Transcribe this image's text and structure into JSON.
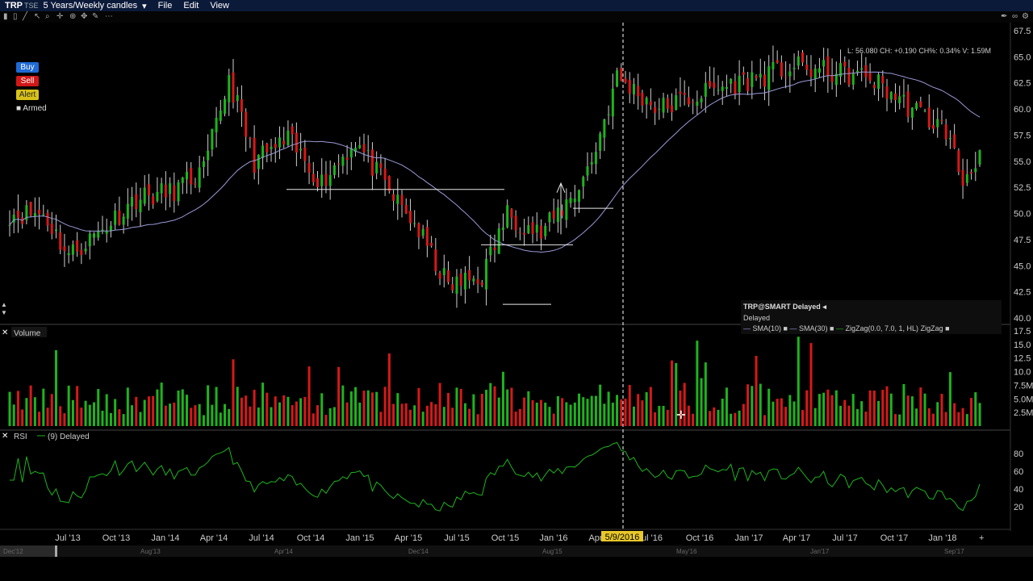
{
  "window": {
    "symbol": "TRP",
    "exchange": "TSE",
    "period": "5 Years/Weekly candles",
    "menu": [
      "File",
      "Edit",
      "View"
    ]
  },
  "order_buttons": {
    "buy": "Buy",
    "sell": "Sell",
    "alert": "Alert",
    "armed": "Armed"
  },
  "quote_readout": "L: 56.080 CH: +0.190 CH%: 0.34% V: 1.59M",
  "legend": {
    "title": "TRP@SMART Delayed",
    "subtitle": "Delayed",
    "items": [
      "SMA(10)",
      "SMA(30)",
      "ZigZag(0.0, 7.0, 1, HL)",
      "ZigZag"
    ]
  },
  "panels": {
    "volume": "Volume",
    "rsi": "RSI",
    "rsi_params": "(9) Delayed"
  },
  "crosshair_date": "5/9/2016",
  "colors": {
    "up": "#1db41d",
    "down": "#d81818",
    "sma30": "#9a9ad8",
    "rsi": "#1db41d",
    "accent": "#e8c82a"
  },
  "chart_data": {
    "type": "candlestick",
    "price_axis": {
      "range": [
        40,
        67.5
      ],
      "ticks": [
        "67.5",
        "65.0",
        "62.5",
        "60.0",
        "57.5",
        "55.0",
        "52.5",
        "50.0",
        "47.5",
        "45.0",
        "42.5",
        "40.0"
      ]
    },
    "volume_axis": {
      "range": [
        0,
        17.5
      ],
      "ticks": [
        "17.5",
        "15.0",
        "12.5",
        "10.0",
        "7.5M",
        "5.0M",
        "2.5M"
      ]
    },
    "rsi_axis": {
      "range": [
        0,
        100
      ],
      "ticks": [
        "80",
        "60",
        "40",
        "20"
      ]
    },
    "x_tick_labels": [
      "Jul '13",
      "Oct '13",
      "Jan '14",
      "Apr '14",
      "Jul '14",
      "Oct '14",
      "Jan '15",
      "Apr '15",
      "Jul '15",
      "Oct '15",
      "Jan '16",
      "Apr",
      "ul '16",
      "Oct '16",
      "Jan '17",
      "Apr '17",
      "Jul '17",
      "Oct '17",
      "Jan '18"
    ],
    "overview_labels": [
      "Dec'12",
      "Aug'13",
      "Apr'14",
      "Dec'14",
      "Aug'15",
      "May'16",
      "Jan'17",
      "Sep'17"
    ],
    "close_anchors": [
      [
        0,
        50
      ],
      [
        8,
        50
      ],
      [
        14,
        46
      ],
      [
        22,
        48.5
      ],
      [
        30,
        51.5
      ],
      [
        38,
        52
      ],
      [
        46,
        54
      ],
      [
        52,
        63
      ],
      [
        58,
        55
      ],
      [
        66,
        57
      ],
      [
        74,
        53
      ],
      [
        82,
        57
      ],
      [
        90,
        52
      ],
      [
        96,
        49
      ],
      [
        104,
        43
      ],
      [
        112,
        44
      ],
      [
        118,
        50
      ],
      [
        126,
        48
      ],
      [
        134,
        52
      ],
      [
        138,
        55
      ],
      [
        144,
        63
      ],
      [
        154,
        60
      ],
      [
        168,
        62
      ],
      [
        186,
        64
      ],
      [
        204,
        63
      ],
      [
        214,
        60
      ],
      [
        222,
        58
      ],
      [
        226,
        53
      ],
      [
        230,
        56
      ]
    ]
  }
}
